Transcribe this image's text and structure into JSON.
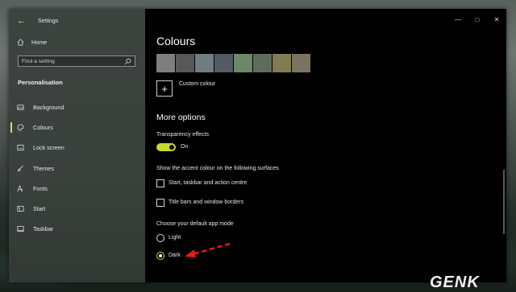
{
  "window": {
    "title": "Settings"
  },
  "sidebar": {
    "home_label": "Home",
    "search_placeholder": "Find a setting",
    "section_title": "Personalisation",
    "items": [
      {
        "label": "Background",
        "icon": "image-icon"
      },
      {
        "label": "Colours",
        "icon": "palette-icon",
        "active": true
      },
      {
        "label": "Lock screen",
        "icon": "lock-screen-icon"
      },
      {
        "label": "Themes",
        "icon": "brush-icon"
      },
      {
        "label": "Fonts",
        "icon": "font-icon"
      },
      {
        "label": "Start",
        "icon": "start-icon"
      },
      {
        "label": "Taskbar",
        "icon": "taskbar-icon"
      }
    ]
  },
  "main": {
    "title": "Colours",
    "swatches": [
      "#7d7f7e",
      "#575957",
      "#6f7d80",
      "#535a63",
      "#6b8868",
      "#5f6b5c",
      "#817b52",
      "#7a735f"
    ],
    "custom_colour_label": "Custom colour",
    "more_options_title": "More options",
    "transparency": {
      "label": "Transparency effects",
      "state": "On"
    },
    "accent_surfaces": {
      "label": "Show the accent colour on the following surfaces",
      "options": [
        {
          "label": "Start, taskbar and action centre",
          "checked": false
        },
        {
          "label": "Title bars and window borders",
          "checked": false
        }
      ]
    },
    "app_mode": {
      "label": "Choose your default app mode",
      "options": [
        {
          "label": "Light",
          "selected": false
        },
        {
          "label": "Dark",
          "selected": true
        }
      ]
    }
  },
  "accent_color": "#d5e33a",
  "arrow_color": "#e51b1b",
  "watermark": "GENK"
}
